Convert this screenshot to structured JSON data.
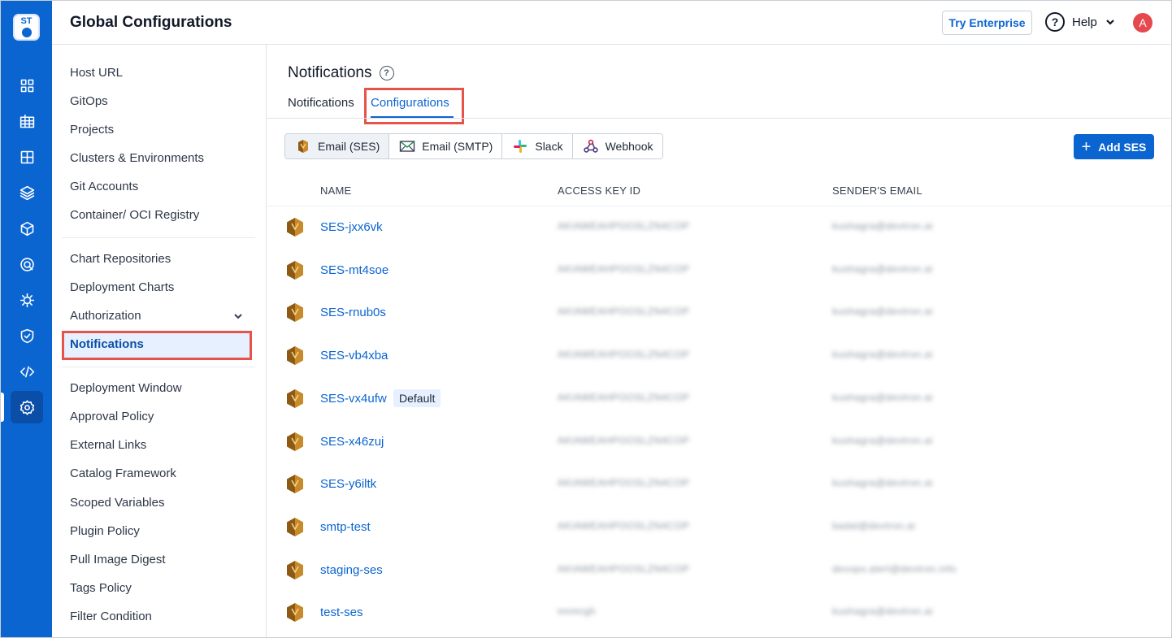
{
  "header": {
    "title": "Global Configurations",
    "try_enterprise": "Try Enterprise",
    "help_label": "Help",
    "avatar_initial": "A"
  },
  "rail": {
    "logo_text": "ST",
    "items": [
      "apps-icon",
      "grid-table-icon",
      "dashboard-icon",
      "layers-icon",
      "cube-icon",
      "target-icon",
      "bug-icon",
      "shield-check-icon",
      "code-icon",
      "gear-icon"
    ]
  },
  "sidebar": {
    "group1": [
      "Host URL",
      "GitOps",
      "Projects",
      "Clusters & Environments",
      "Git Accounts",
      "Container/ OCI Registry"
    ],
    "group2": [
      "Chart Repositories",
      "Deployment Charts",
      "Authorization"
    ],
    "active": "Notifications",
    "group3": [
      "Deployment Window",
      "Approval Policy",
      "External Links",
      "Catalog Framework",
      "Scoped Variables",
      "Plugin Policy",
      "Pull Image Digest",
      "Tags Policy",
      "Filter Condition"
    ]
  },
  "main": {
    "title": "Notifications",
    "help_glyph": "?",
    "tabs": [
      {
        "label": "Notifications"
      },
      {
        "label": "Configurations"
      }
    ],
    "segments": [
      {
        "label": "Email (SES)",
        "icon": "aws-ses-icon"
      },
      {
        "label": "Email (SMTP)",
        "icon": "mail-icon"
      },
      {
        "label": "Slack",
        "icon": "slack-icon"
      },
      {
        "label": "Webhook",
        "icon": "webhook-icon"
      }
    ],
    "add_button": "Add SES",
    "add_glyph": "+",
    "columns": [
      "NAME",
      "ACCESS KEY ID",
      "SENDER'S EMAIL"
    ],
    "rows": [
      {
        "name": "SES-jxx6vk",
        "badge": "",
        "key": "AKIAWEAHPOOSLZN4COP",
        "email": "kushagra@devtron.ai"
      },
      {
        "name": "SES-mt4soe",
        "badge": "",
        "key": "AKIAWEAHPOOSLZN4COP",
        "email": "kushagra@devtron.ai"
      },
      {
        "name": "SES-rnub0s",
        "badge": "",
        "key": "AKIAWEAHPOOSLZN4COP",
        "email": "kushagra@devtron.ai"
      },
      {
        "name": "SES-vb4xba",
        "badge": "",
        "key": "AKIAWEAHPOOSLZN4COP",
        "email": "kushagra@devtron.ai"
      },
      {
        "name": "SES-vx4ufw",
        "badge": "Default",
        "key": "AKIAWEAHPOOSLZN4COP",
        "email": "kushagra@devtron.ai"
      },
      {
        "name": "SES-x46zuj",
        "badge": "",
        "key": "AKIAWEAHPOOSLZN4COP",
        "email": "kushagra@devtron.ai"
      },
      {
        "name": "SES-y6iltk",
        "badge": "",
        "key": "AKIAWEAHPOOSLZN4COP",
        "email": "kushagra@devtron.ai"
      },
      {
        "name": "smtp-test",
        "badge": "",
        "key": "AKIAWEAHPOOSLZN4COP",
        "email": "badal@devtron.ai"
      },
      {
        "name": "staging-ses",
        "badge": "",
        "key": "AKIAWEAHPOOSLZN4COP",
        "email": "devops.alert@devtron.info"
      },
      {
        "name": "test-ses",
        "badge": "",
        "key": "mnmrgh",
        "email": "kushagra@devtron.ai"
      }
    ]
  },
  "colors": {
    "brand": "#0b65d1",
    "highlight": "#e5534b"
  }
}
